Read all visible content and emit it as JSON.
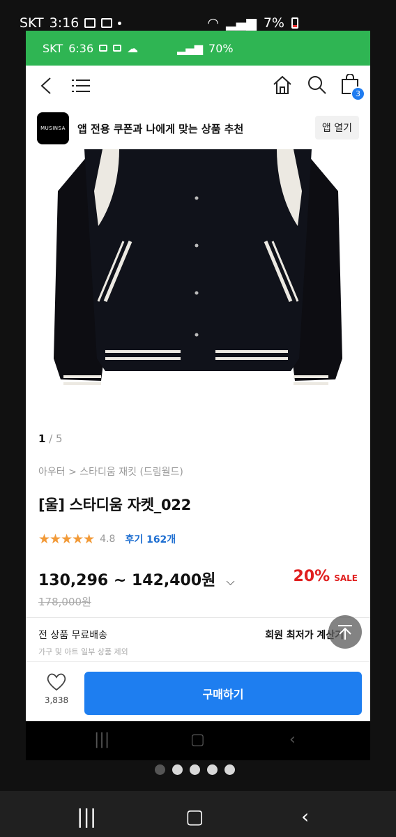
{
  "outer_status": {
    "carrier": "SKT",
    "time": "3:16",
    "battery": "7%"
  },
  "inner_status": {
    "carrier": "SKT",
    "time": "6:36",
    "battery": "70%"
  },
  "appbar": {
    "cart_count": "3"
  },
  "banner": {
    "brand": "MUSINSA",
    "text": "앱 전용 쿠폰과 나에게 맞는 상품 추천",
    "button": "앱 열기"
  },
  "product": {
    "image_index": "1",
    "image_total": "/ 5",
    "breadcrumb": "아우터 > 스타디움 재킷 (드림월드)",
    "title": "[울] 스타디움 자켓_022",
    "stars": "★★★★★",
    "rating": "4.8",
    "reviews": "후기 162개",
    "price": "130,296 ~ 142,400원",
    "discount": "20%",
    "sale_label": "SALE",
    "original_price": "178,000원",
    "shipping": "전 상품 무료배송",
    "shipping_sub": "가구 및 아트 일부 상품 제외",
    "member_price": "회원 최저가 계산기"
  },
  "bottom": {
    "like_count": "3,838",
    "buy_label": "구매하기"
  },
  "colors": {
    "status_green": "#2fb553",
    "accent_blue": "#1e7ef0",
    "sale_red": "#e02020",
    "star_orange": "#f29a38"
  }
}
